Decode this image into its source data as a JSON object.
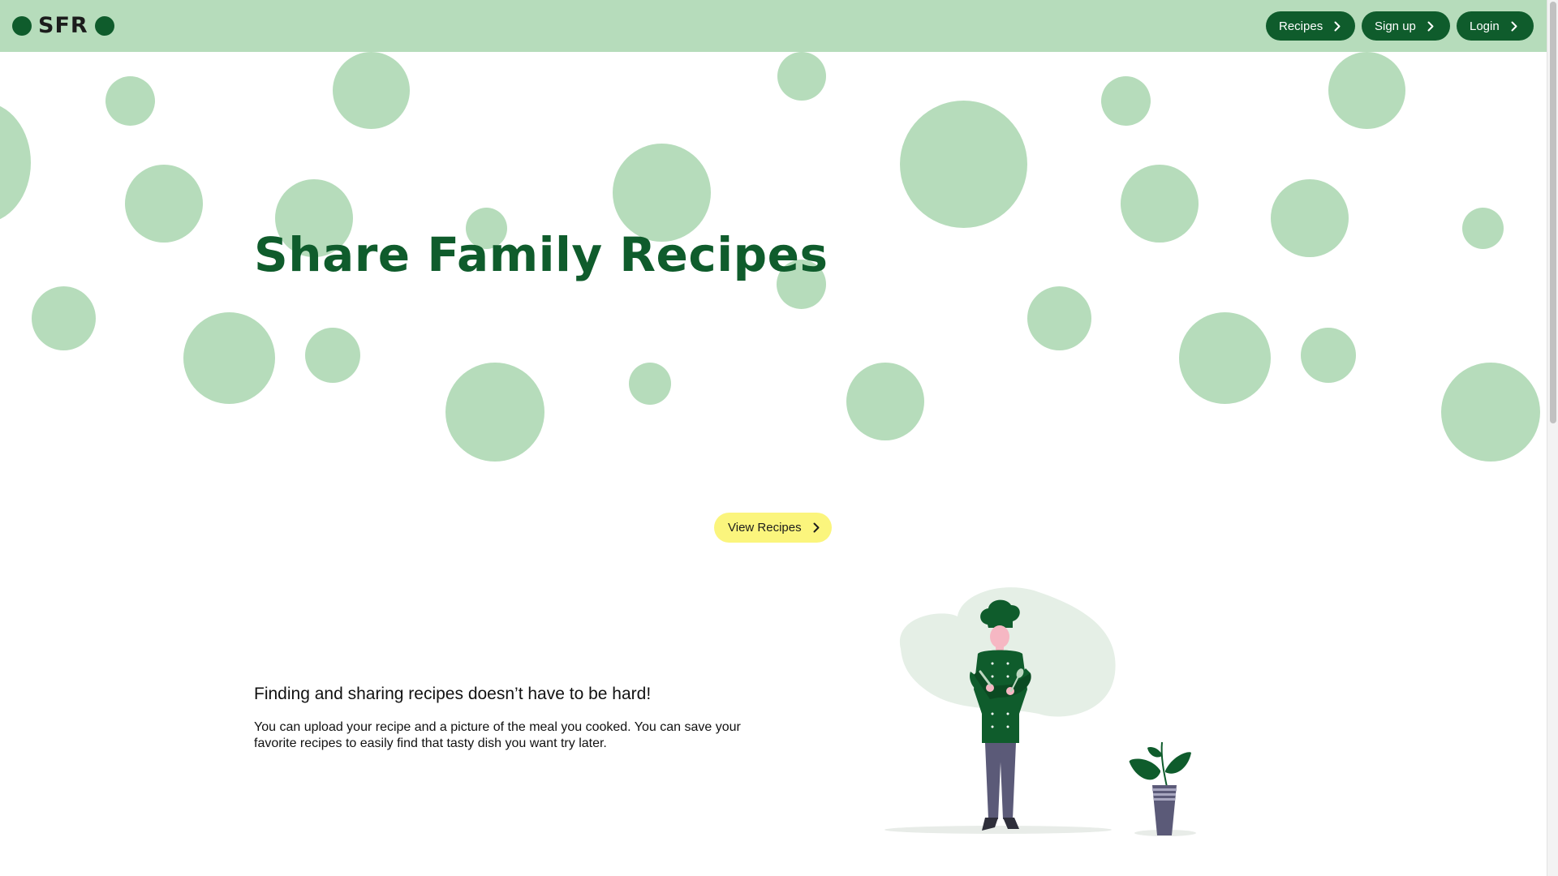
{
  "header": {
    "logo_text": "SFR",
    "nav": [
      {
        "label": "Recipes"
      },
      {
        "label": "Sign up"
      },
      {
        "label": "Login"
      }
    ]
  },
  "hero": {
    "title": "Share Family Recipes",
    "cta_label": "View Recipes"
  },
  "info": {
    "heading": "Finding and sharing recipes doesn’t have to be hard!",
    "body": "You can upload your recipe and a picture of the meal you cooked. You can save your favorite recipes to easily find that tasty dish you want try later."
  },
  "colors": {
    "brand_green": "#0f5c2c",
    "light_green": "#b6dcbb",
    "cta_yellow": "#fbf57d",
    "pants": "#5b5a78",
    "skin": "#f6b7c3"
  },
  "icons": [
    "chevron-right-icon",
    "chef-illustration",
    "plant-illustration"
  ]
}
